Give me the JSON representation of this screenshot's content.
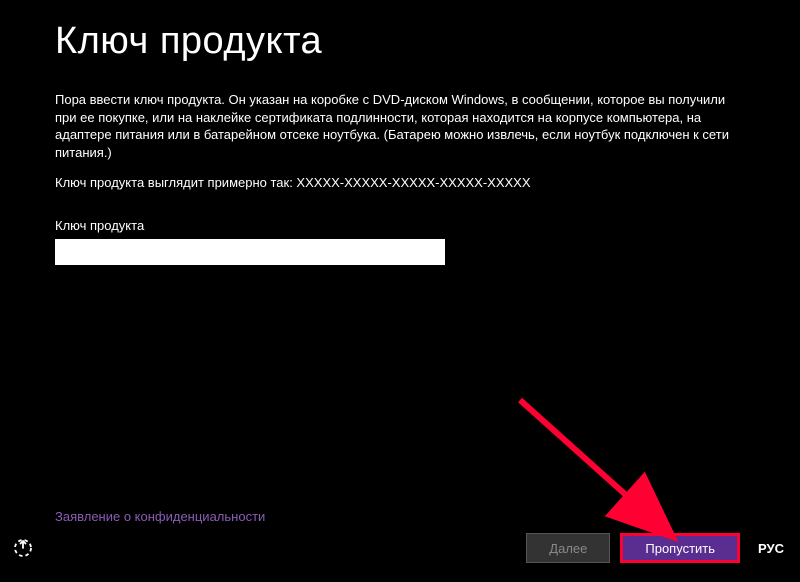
{
  "title": "Ключ продукта",
  "description": "Пора ввести ключ продукта. Он указан на коробке с DVD-диском Windows, в сообщении, которое вы получили при ее покупке, или на наклейке сертификата подлинности, которая находится на корпусе компьютера, на адаптере питания или в батарейном отсеке ноутбука. (Батарею можно извлечь, если ноутбук подключен к сети питания.)",
  "format_line": "Ключ продукта выглядит примерно так: XXXXX-XXXXX-XXXXX-XXXXX-XXXXX",
  "field_label": "Ключ продукта",
  "input_value": "",
  "privacy_link": "Заявление о конфиденциальности",
  "buttons": {
    "next": "Далее",
    "skip": "Пропустить"
  },
  "lang": "РУС"
}
